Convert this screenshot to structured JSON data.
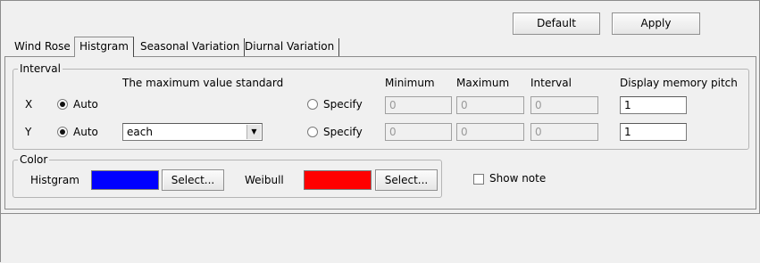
{
  "toolbar": {
    "default_label": "Default",
    "apply_label": "Apply"
  },
  "tabs": [
    {
      "label": "Wind Rose",
      "active": false
    },
    {
      "label": "Histgram",
      "active": true
    },
    {
      "label": "Seasonal Variation",
      "active": false
    },
    {
      "label": "Diurnal Variation",
      "active": false
    }
  ],
  "interval": {
    "title": "Interval",
    "max_standard_header": "The maximum value standard",
    "columns": {
      "minimum": "Minimum",
      "maximum": "Maximum",
      "interval": "Interval",
      "pitch": "Display memory pitch"
    },
    "rows": [
      {
        "axis": "X",
        "auto_label": "Auto",
        "auto_selected": true,
        "specify_label": "Specify",
        "minimum": "0",
        "maximum": "0",
        "interval": "0",
        "pitch": "1"
      },
      {
        "axis": "Y",
        "auto_label": "Auto",
        "auto_selected": true,
        "standard_value": "each",
        "specify_label": "Specify",
        "minimum": "0",
        "maximum": "0",
        "interval": "0",
        "pitch": "1"
      }
    ]
  },
  "color": {
    "title": "Color",
    "histgram_label": "Histgram",
    "histgram_color": "#0000ff",
    "weibull_label": "Weibull",
    "weibull_color": "#ff0000",
    "select_label": "Select..."
  },
  "show_note": {
    "label": "Show note",
    "checked": false
  }
}
